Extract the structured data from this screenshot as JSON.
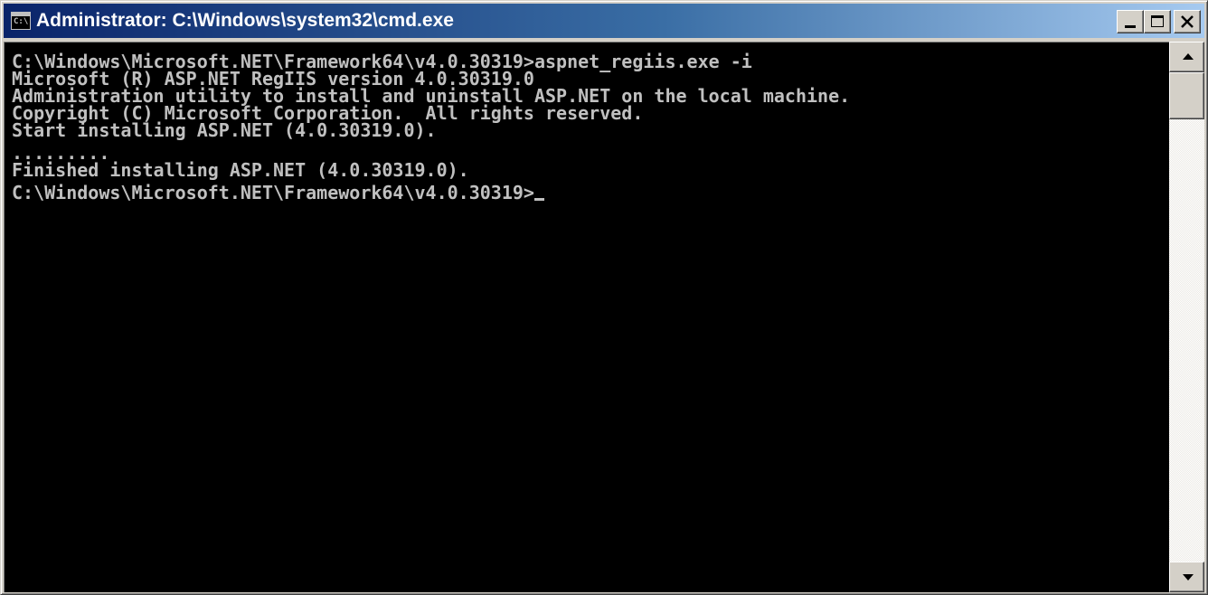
{
  "window": {
    "title": "Administrator: C:\\Windows\\system32\\cmd.exe",
    "icon": "cmd-console-icon",
    "icon_text": "C:\\",
    "buttons": {
      "minimize": "minimize-icon",
      "maximize": "maximize-icon",
      "close": "close-icon"
    }
  },
  "console": {
    "colors": {
      "background": "#000000",
      "text": "#c0c0c0"
    },
    "lines": [
      "C:\\Windows\\Microsoft.NET\\Framework64\\v4.0.30319>aspnet_regiis.exe -i",
      "Microsoft (R) ASP.NET RegIIS version 4.0.30319.0",
      "Administration utility to install and uninstall ASP.NET on the local machine.",
      "Copyright (C) Microsoft Corporation.  All rights reserved.",
      "Start installing ASP.NET (4.0.30319.0).",
      ".........",
      "Finished installing ASP.NET (4.0.30319.0).",
      "C:\\Windows\\Microsoft.NET\\Framework64\\v4.0.30319>"
    ]
  },
  "scrollbar": {
    "up_icon": "scroll-up-arrow-icon",
    "down_icon": "scroll-down-arrow-icon"
  }
}
